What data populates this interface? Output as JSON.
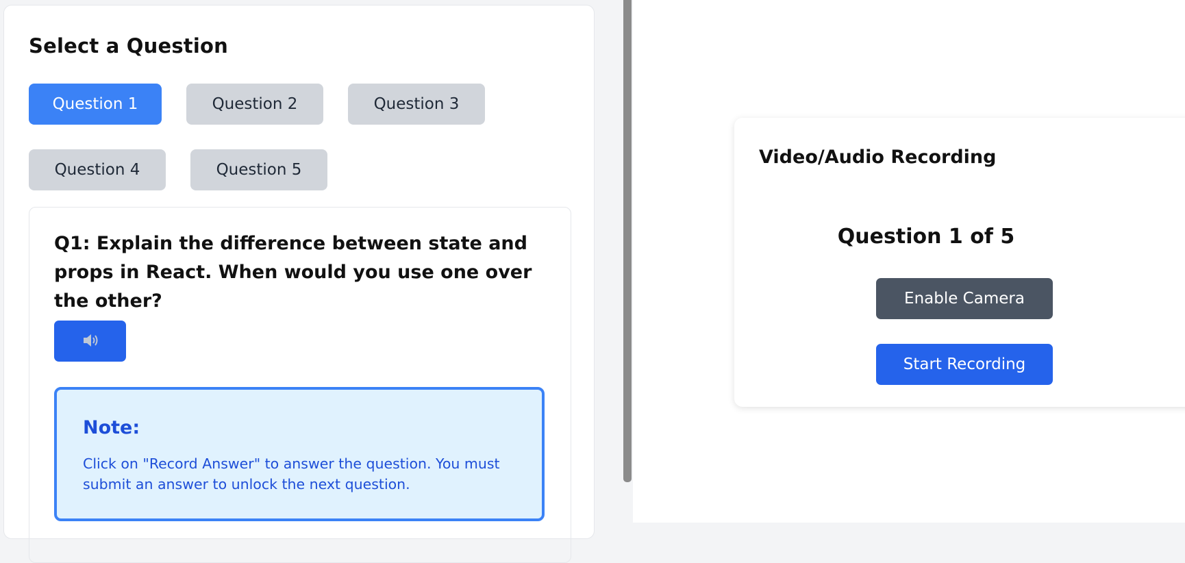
{
  "left_panel": {
    "title": "Select a Question",
    "question_buttons": [
      "Question 1",
      "Question 2",
      "Question 3",
      "Question 4",
      "Question 5"
    ],
    "active_question": "Question 1",
    "question": {
      "text": "Q1: Explain the difference between state and props in React. When would you use one over the other?",
      "speak_icon": "speaker-icon"
    },
    "note": {
      "title": "Note:",
      "text": "Click on \"Record Answer\" to answer the question. You must submit an answer to unlock the next question."
    }
  },
  "recording_panel": {
    "title": "Video/Audio Recording",
    "progress": "Question 1 of 5",
    "enable_camera_label": "Enable Camera",
    "start_recording_label": "Start Recording"
  },
  "colors": {
    "active_button": "#3b82f6",
    "inactive_button": "#d1d5db",
    "primary_blue": "#2563eb",
    "gray_button": "#4b5563",
    "note_background": "#e0f2fe",
    "note_text": "#1d4ed8"
  }
}
